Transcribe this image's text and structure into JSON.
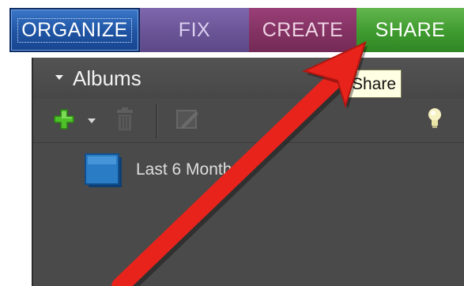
{
  "tabs": {
    "organize": "ORGANIZE",
    "fix": "FIX",
    "create": "CREATE",
    "share": "SHARE"
  },
  "panel": {
    "section_title": "Albums",
    "albums": [
      {
        "label": "Last 6 Months"
      }
    ]
  },
  "tooltip": {
    "text": "Share"
  },
  "colors": {
    "organize": "#1f54a3",
    "fix": "#6a5496",
    "create": "#833262",
    "share": "#3f9b2f",
    "arrow": "#e8231c",
    "panel_bg": "#4a4a4a"
  },
  "icons": [
    "plus-icon",
    "chevron-down-icon",
    "trash-icon",
    "edit-icon",
    "lightbulb-icon",
    "album-icon",
    "arrow-annotation"
  ]
}
